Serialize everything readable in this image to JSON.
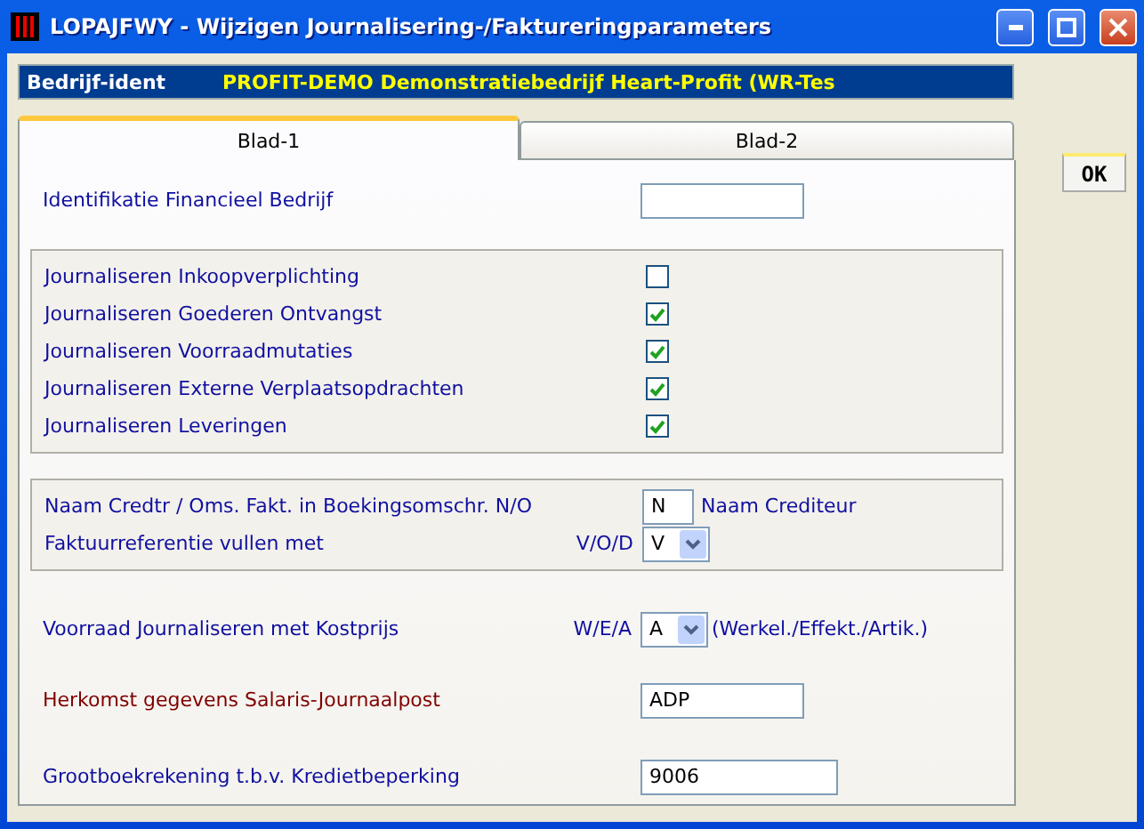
{
  "window": {
    "title": "LOPAJFWY - Wijzigen Journalisering-/Faktureringparameters"
  },
  "header": {
    "label": "Bedrijf-ident",
    "value": "PROFIT-DEMO Demonstratiebedrijf Heart-Profit (WR-Tes"
  },
  "tabs": [
    {
      "label": "Blad-1",
      "selected": true
    },
    {
      "label": "Blad-2",
      "selected": false
    }
  ],
  "ok_button": "OK",
  "identification": {
    "label": "Identifikatie Financieel Bedrijf"
  },
  "journal_options": [
    {
      "label": "Journaliseren Inkoopverplichting",
      "checked": false
    },
    {
      "label": "Journaliseren Goederen Ontvangst",
      "checked": true
    },
    {
      "label": "Journaliseren Voorraadmutaties",
      "checked": true
    },
    {
      "label": "Journaliseren Externe Verplaatsopdrachten",
      "checked": true
    },
    {
      "label": "Journaliseren Leveringen",
      "checked": true
    }
  ],
  "creditor_name": {
    "label": "Naam Credtr / Oms. Fakt. in Boekingsomschr. N/O",
    "value": "N",
    "note": "Naam Crediteur"
  },
  "invoice_reference": {
    "label": "Faktuurreferentie vullen met",
    "options_hint": "V/O/D",
    "value": "V"
  },
  "stock_cost": {
    "label": "Voorraad Journaliseren met Kostprijs",
    "options_hint": "W/E/A",
    "value": "A",
    "note": "(Werkel./Effekt./Artik.)"
  },
  "salary_source": {
    "label": "Herkomst gegevens Salaris-Journaalpost",
    "value": "ADP"
  },
  "credit_account": {
    "label": "Grootboekrekening t.b.v. Kredietbeperking",
    "value": "9006"
  }
}
